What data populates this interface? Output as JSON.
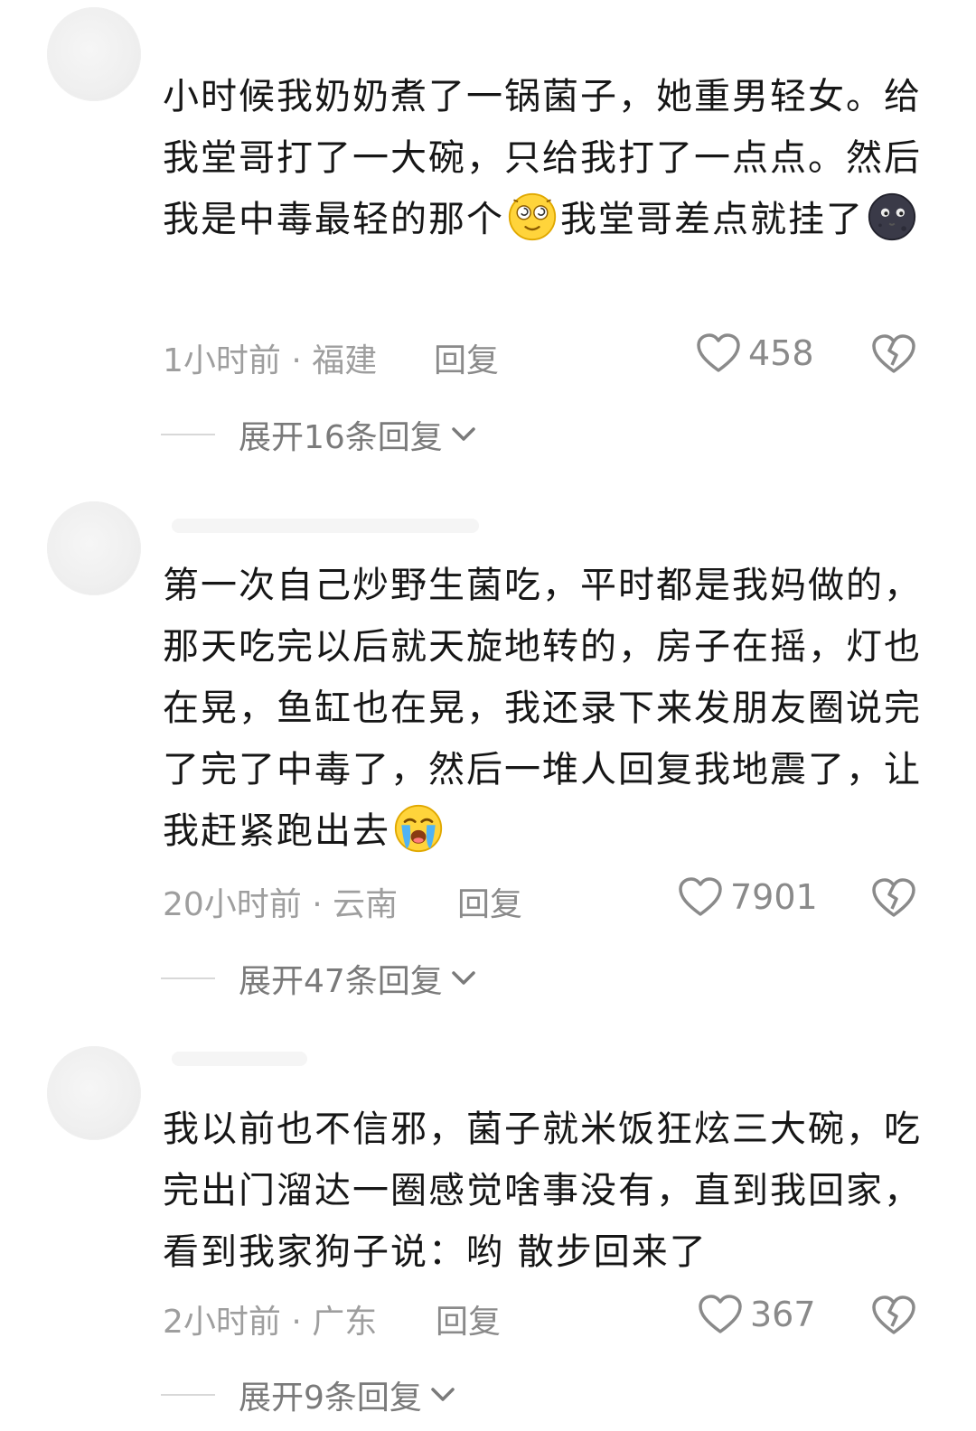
{
  "colors": {
    "text": "#161616",
    "meta": "#9e9e9e",
    "action": "#8a8a8a"
  },
  "comments": [
    {
      "text_parts": [
        "小时候我奶奶煮了一锅菌子，她重男轻女。给我堂哥打了一大碗，只给我打了一点点。然后我是中毒最轻的那个",
        "我堂哥差点就挂了"
      ],
      "emojis": [
        "dizzy-face-emoji",
        "dark-moon-face-emoji"
      ],
      "time_location": "1小时前 · 福建",
      "reply_label": "回复",
      "likes": "458",
      "expand_label": "展开16条回复"
    },
    {
      "text_parts": [
        "第一次自己炒野生菌吃，平时都是我妈做的，那天吃完以后就天旋地转的，房子在摇，灯也在晃，鱼缸也在晃，我还录下来发朋友圈说完了完了中毒了，然后一堆人回复我地震了，让我赶紧跑出去"
      ],
      "emojis": [
        "crying-face-emoji"
      ],
      "time_location": "20小时前 · 云南",
      "reply_label": "回复",
      "likes": "7901",
      "expand_label": "展开47条回复"
    },
    {
      "text_parts": [
        "我以前也不信邪，菌子就米饭狂炫三大碗，吃完出门溜达一圈感觉啥事没有，直到我回家，看到我家狗子说：哟 散步回来了"
      ],
      "emojis": [],
      "time_location": "2小时前 · 广东",
      "reply_label": "回复",
      "likes": "367",
      "expand_label": "展开9条回复"
    }
  ]
}
